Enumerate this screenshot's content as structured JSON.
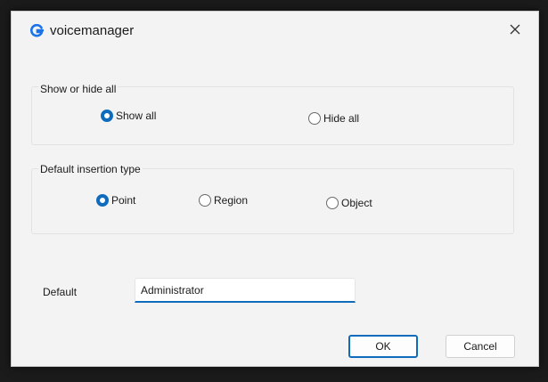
{
  "window": {
    "title": "voicemanager",
    "app_icon": "app-logo-icon",
    "close_icon": "close-icon",
    "accent_color": "#0f6cbd"
  },
  "show_hide_group": {
    "label": "Show or hide all",
    "options": [
      {
        "label": "Show all",
        "checked": true
      },
      {
        "label": "Hide all",
        "checked": false
      }
    ]
  },
  "insertion_group": {
    "label": "Default insertion type",
    "options": [
      {
        "label": "Point",
        "checked": true
      },
      {
        "label": "Region",
        "checked": false
      },
      {
        "label": "Object",
        "checked": false
      }
    ]
  },
  "default_field": {
    "label": "Default",
    "value": "Administrator"
  },
  "buttons": {
    "ok_label": "OK",
    "cancel_label": "Cancel"
  }
}
